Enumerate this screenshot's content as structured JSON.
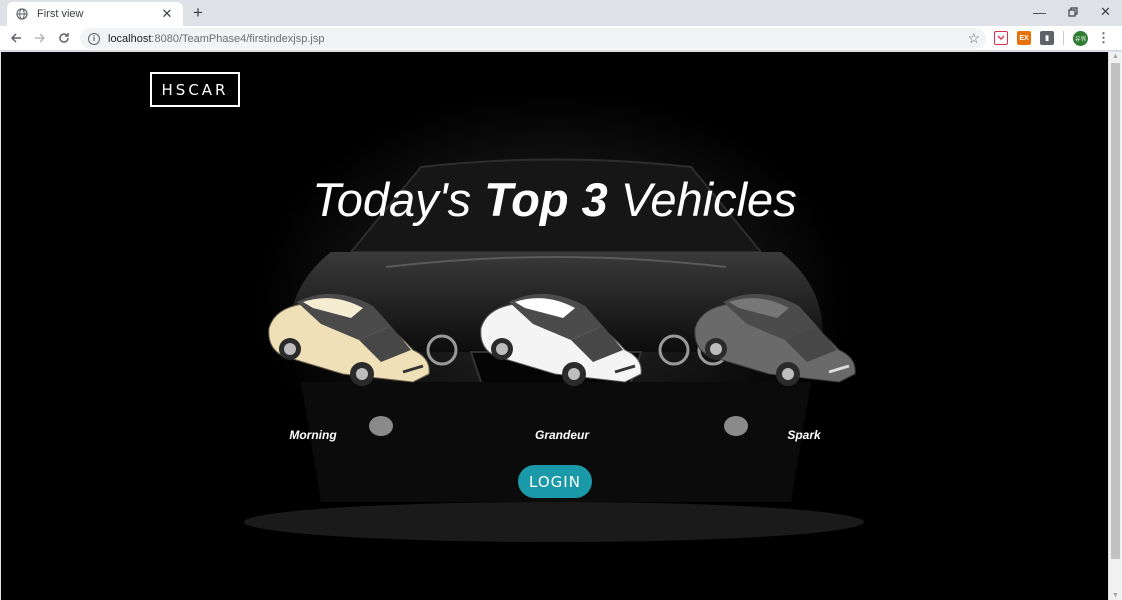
{
  "tab": {
    "title": "First view",
    "favicon": "globe-icon"
  },
  "toolbar": {
    "url_host": "localhost",
    "url_rest": ":8080/TeamPhase4/firstindexjsp.jsp"
  },
  "extensions": {
    "orange_label": "EX",
    "profile_label": "유워"
  },
  "page": {
    "logo": "HSCAR",
    "headline_pre": "Today's ",
    "headline_bold": "Top 3",
    "headline_post": " Vehicles",
    "cars": [
      {
        "label": "Morning",
        "color": "#efe0b8"
      },
      {
        "label": "Grandeur",
        "color": "#f4f4f4"
      },
      {
        "label": "Spark",
        "color": "#6a6a6a"
      }
    ],
    "login_label": "LOGIN"
  },
  "colors": {
    "accent": "#1a9aa8",
    "background": "#000000"
  }
}
